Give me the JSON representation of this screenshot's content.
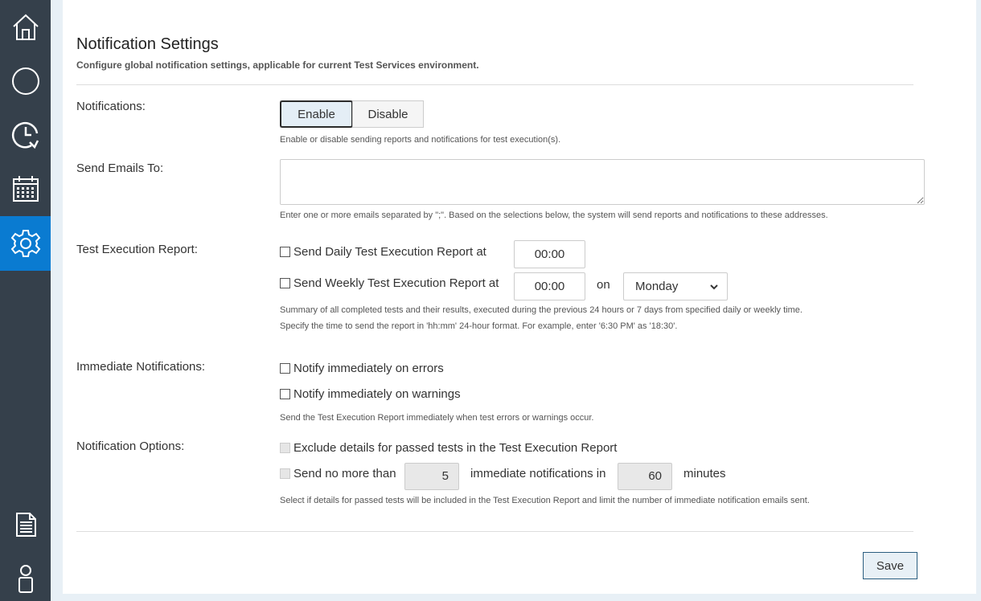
{
  "sidebar": {
    "items": [
      {
        "icon": "home-icon"
      },
      {
        "icon": "circle-icon"
      },
      {
        "icon": "clock-refresh-icon"
      },
      {
        "icon": "calendar-icon"
      },
      {
        "icon": "gear-icon",
        "active": true
      },
      {
        "icon": "document-icon"
      },
      {
        "icon": "user-icon"
      }
    ],
    "background": "#35404b",
    "active_color": "#0a7bd1"
  },
  "header": {
    "title": "Notification Settings",
    "subtitle": "Configure global notification settings, applicable for current Test Services environment."
  },
  "notifications": {
    "label": "Notifications:",
    "enable_label": "Enable",
    "disable_label": "Disable",
    "selected": "Enable",
    "help": "Enable or disable sending reports and notifications for test execution(s)."
  },
  "emails": {
    "label": "Send Emails To:",
    "value": "",
    "help": "Enter one or more emails separated by \";\". Based on the selections below, the system will send reports and notifications to these addresses."
  },
  "report": {
    "label": "Test Execution Report:",
    "daily_label": "Send Daily Test Execution Report at",
    "daily_checked": false,
    "daily_time": "00:00",
    "weekly_label": "Send Weekly Test Execution Report at",
    "weekly_checked": false,
    "weekly_time": "00:00",
    "on_label": "on",
    "weekly_day": "Monday",
    "help1": "Summary of all completed tests and their results, executed during the previous 24 hours or 7 days from specified daily or weekly time.",
    "help2": "Specify the time to send the report in 'hh:mm' 24-hour format. For example, enter '6:30 PM' as '18:30'."
  },
  "immediate": {
    "label": "Immediate Notifications:",
    "errors_label": "Notify immediately on errors",
    "errors_checked": false,
    "warnings_label": "Notify immediately on warnings",
    "warnings_checked": false,
    "help": "Send the Test Execution Report immediately when test errors or warnings occur."
  },
  "options": {
    "label": "Notification Options:",
    "exclude_label": "Exclude details for passed tests in the Test Execution Report",
    "limit_prefix": "Send no more than",
    "limit_count": "5",
    "limit_middle": "immediate notifications in",
    "limit_minutes": "60",
    "limit_suffix": "minutes",
    "help": "Select if details for passed tests will be included in the Test Execution Report and limit the number of immediate notification emails sent."
  },
  "footer": {
    "save_label": "Save"
  }
}
